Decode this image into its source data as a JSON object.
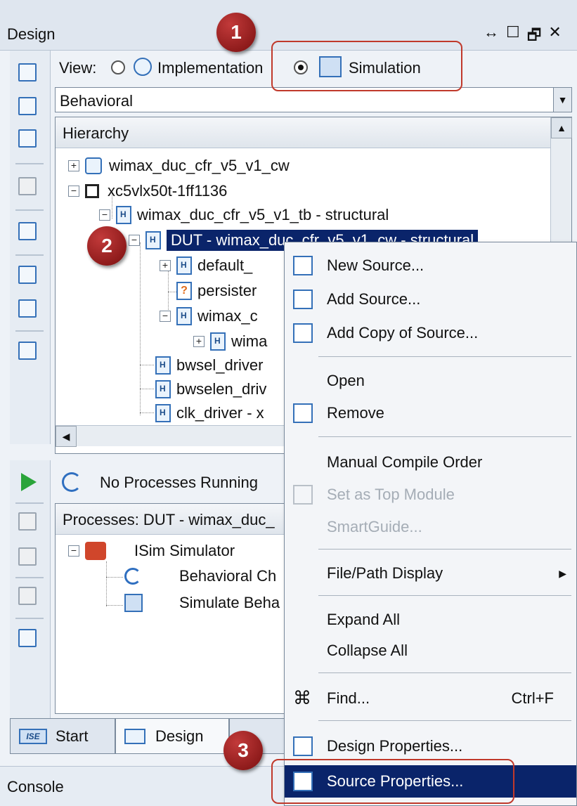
{
  "window": {
    "title": "Design",
    "controls": [
      "↔",
      "☐",
      "🗗",
      "✕"
    ]
  },
  "view": {
    "label": "View:",
    "implementation_label": "Implementation",
    "simulation_label": "Simulation",
    "selected": "Simulation"
  },
  "combo": {
    "value": "Behavioral"
  },
  "hierarchy": {
    "header": "Hierarchy",
    "nodes": [
      "wimax_duc_cfr_v5_v1_cw",
      "xc5vlx50t-1ff1136",
      "wimax_duc_cfr_v5_v1_tb - structural",
      "DUT - wimax_duc_cfr_v5_v1_cw - structural",
      "default_",
      "persister",
      "wimax_c",
      "wima",
      "bwsel_driver",
      "bwselen_driv",
      "clk_driver - x"
    ]
  },
  "processes": {
    "status": "No Processes Running",
    "header": "Processes: DUT - wimax_duc_",
    "items": [
      "ISim Simulator",
      "Behavioral Ch",
      "Simulate Beha"
    ]
  },
  "tabs": {
    "start": "Start",
    "design": "Design",
    "ise_badge": "ISE"
  },
  "console": {
    "label": "Console"
  },
  "context_menu": {
    "items": [
      {
        "label": "New Source...",
        "icon": "new-source-icon"
      },
      {
        "label": "Add Source...",
        "icon": "add-source-icon"
      },
      {
        "label": "Add Copy of Source...",
        "icon": "add-copy-icon"
      },
      {
        "label": "Open"
      },
      {
        "label": "Remove",
        "icon": "remove-icon"
      },
      {
        "label": "Manual Compile Order"
      },
      {
        "label": "Set as Top Module",
        "disabled": true,
        "icon": "top-module-icon"
      },
      {
        "label": "SmartGuide...",
        "disabled": true
      },
      {
        "label": "File/Path Display",
        "submenu": true
      },
      {
        "label": "Expand All"
      },
      {
        "label": "Collapse All"
      },
      {
        "label": "Find...",
        "shortcut": "Ctrl+F",
        "icon": "binoculars-icon"
      },
      {
        "label": "Design Properties...",
        "icon": "design-properties-icon"
      },
      {
        "label": "Source Properties...",
        "icon": "source-properties-icon",
        "highlighted": true
      }
    ]
  },
  "callouts": [
    "1",
    "2",
    "3"
  ],
  "colors": {
    "selection": "#0a246a",
    "callout": "#9b1c1c",
    "highlight_box": "#c0392b"
  }
}
